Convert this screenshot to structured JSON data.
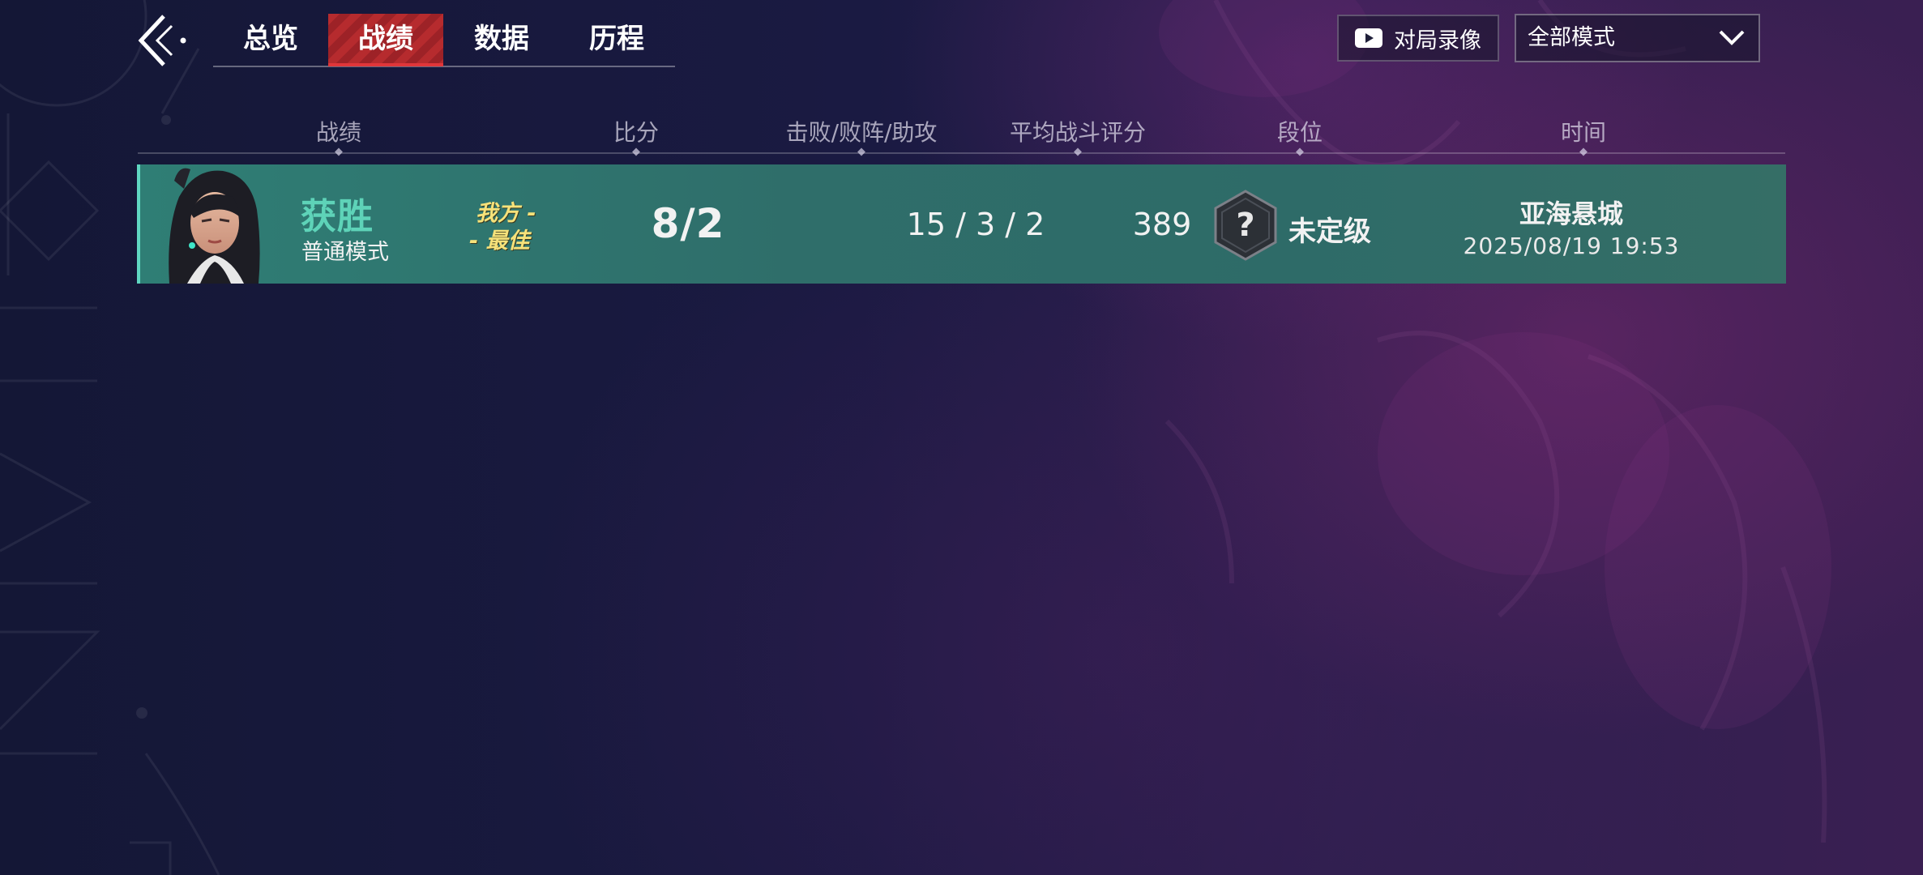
{
  "nav": {
    "tabs": [
      {
        "label": "总览",
        "active": false
      },
      {
        "label": "战绩",
        "active": true
      },
      {
        "label": "数据",
        "active": false
      },
      {
        "label": "历程",
        "active": false
      }
    ]
  },
  "toolbar": {
    "replay_label": "对局录像",
    "mode_filter_value": "全部模式"
  },
  "table": {
    "columns": [
      "战绩",
      "比分",
      "击败/败阵/助攻",
      "平均战斗评分",
      "段位",
      "时间"
    ]
  },
  "matches": [
    {
      "result": "获胜",
      "mode": "普通模式",
      "badge_line1": "我方 -",
      "badge_line2": "- 最佳",
      "score": "8/2",
      "kda": "15 / 3 / 2",
      "avg_rating": "389",
      "rank": "未定级",
      "map": "亚海悬城",
      "time": "2025/08/19 19:53"
    }
  ],
  "colors": {
    "accent_tab": "#b62b2e",
    "win_text": "#5ed3b8",
    "row_bg": "#2f7e75",
    "mvp_text": "#f6e27a"
  }
}
